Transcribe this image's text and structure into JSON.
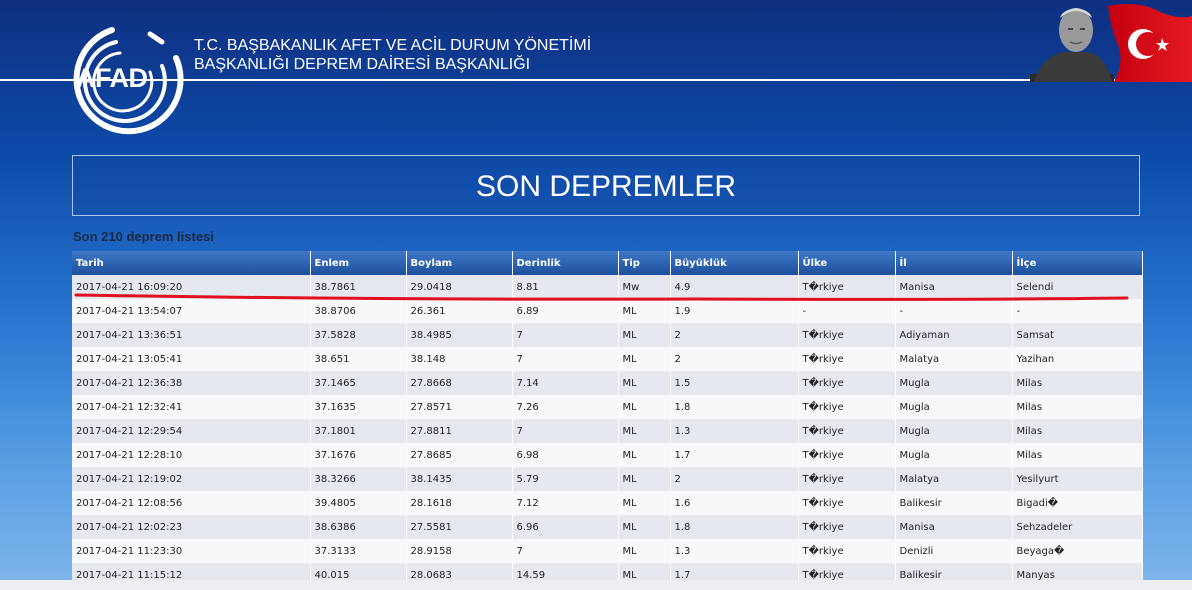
{
  "header": {
    "logo_text": "AFAD",
    "agency_line1": "T.C. BAŞBAKANLIK AFET VE ACİL DURUM YÖNETİMİ",
    "agency_line2": "BAŞKANLIĞI DEPREM DAİRESİ BAŞKANLIĞI"
  },
  "page_title": "SON DEPREMLER",
  "list_caption": "Son 210 deprem listesi",
  "table": {
    "columns": [
      "Tarih",
      "Enlem",
      "Boylam",
      "Derinlik",
      "Tip",
      "Büyüklük",
      "Ülke",
      "İl",
      "İlçe"
    ],
    "rows": [
      [
        "2017-04-21 16:09:20",
        "38.7861",
        "29.0418",
        "8.81",
        "Mw",
        "4.9",
        "T�rkiye",
        "Manisa",
        "Selendi"
      ],
      [
        "2017-04-21 13:54:07",
        "38.8706",
        "26.361",
        "6.89",
        "ML",
        "1.9",
        "-",
        "-",
        "-"
      ],
      [
        "2017-04-21 13:36:51",
        "37.5828",
        "38.4985",
        "7",
        "ML",
        "2",
        "T�rkiye",
        "Adiyaman",
        "Samsat"
      ],
      [
        "2017-04-21 13:05:41",
        "38.651",
        "38.148",
        "7",
        "ML",
        "2",
        "T�rkiye",
        "Malatya",
        "Yazihan"
      ],
      [
        "2017-04-21 12:36:38",
        "37.1465",
        "27.8668",
        "7.14",
        "ML",
        "1.5",
        "T�rkiye",
        "Mugla",
        "Milas"
      ],
      [
        "2017-04-21 12:32:41",
        "37.1635",
        "27.8571",
        "7.26",
        "ML",
        "1.8",
        "T�rkiye",
        "Mugla",
        "Milas"
      ],
      [
        "2017-04-21 12:29:54",
        "37.1801",
        "27.8811",
        "7",
        "ML",
        "1.3",
        "T�rkiye",
        "Mugla",
        "Milas"
      ],
      [
        "2017-04-21 12:28:10",
        "37.1676",
        "27.8685",
        "6.98",
        "ML",
        "1.7",
        "T�rkiye",
        "Mugla",
        "Milas"
      ],
      [
        "2017-04-21 12:19:02",
        "38.3266",
        "38.1435",
        "5.79",
        "ML",
        "2",
        "T�rkiye",
        "Malatya",
        "Yesilyurt"
      ],
      [
        "2017-04-21 12:08:56",
        "39.4805",
        "28.1618",
        "7.12",
        "ML",
        "1.6",
        "T�rkiye",
        "Balikesir",
        "Bigadi�"
      ],
      [
        "2017-04-21 12:02:23",
        "38.6386",
        "27.5581",
        "6.96",
        "ML",
        "1.8",
        "T�rkiye",
        "Manisa",
        "Sehzadeler"
      ],
      [
        "2017-04-21 11:23:30",
        "37.3133",
        "28.9158",
        "7",
        "ML",
        "1.3",
        "T�rkiye",
        "Denizli",
        "Beyaga�"
      ],
      [
        "2017-04-21 11:15:12",
        "40.015",
        "28.0683",
        "14.59",
        "ML",
        "1.7",
        "T�rkiye",
        "Balikesir",
        "Manyas"
      ]
    ]
  },
  "colors": {
    "header_dark": "#0f2f80",
    "table_header": "#2b62b3",
    "highlight_underline": "#e01020",
    "row_odd": "#e5e9ef",
    "row_even": "#f7f8fa"
  },
  "icons": {
    "logo": "afad-ring-logo-icon",
    "portrait": "ataturk-portrait-icon",
    "flag": "turkish-flag-icon"
  }
}
